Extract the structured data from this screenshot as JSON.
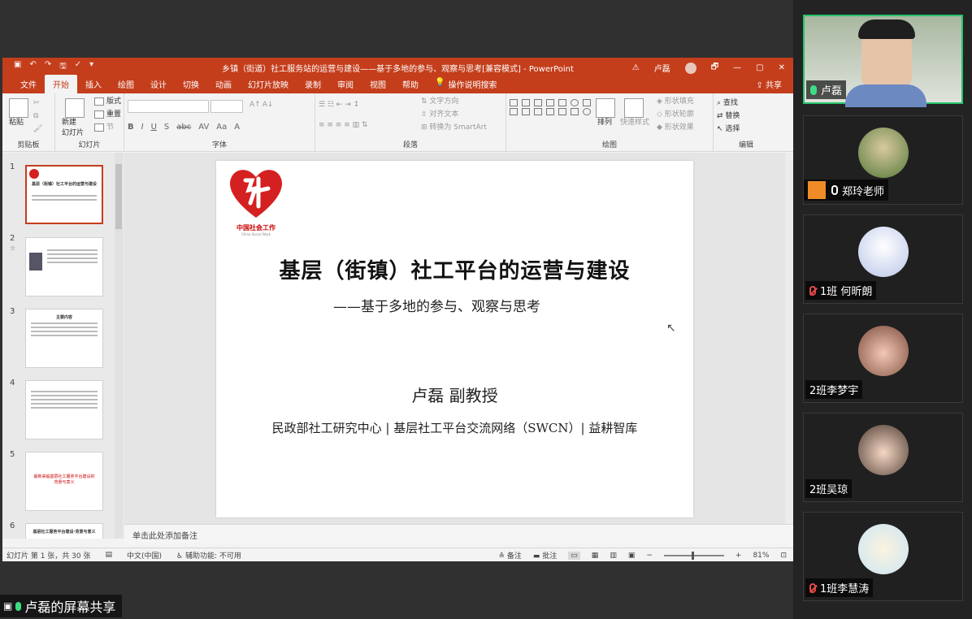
{
  "ppt": {
    "window_title": "乡镇（街道）社工服务站的运营与建设——基于多地的参与、观察与思考[兼容模式] - PowerPoint",
    "user_name": "卢磊",
    "qat": [
      "▣",
      "↶",
      "↷",
      "🖫",
      "✓",
      "▾"
    ],
    "window_buttons": [
      "⚠",
      "🗗",
      "—",
      "▢",
      "✕"
    ],
    "tabs": [
      "文件",
      "开始",
      "插入",
      "绘图",
      "设计",
      "切换",
      "动画",
      "幻灯片放映",
      "录制",
      "审阅",
      "视图",
      "帮助"
    ],
    "search_icon": "lightbulb-icon",
    "search_label": "操作说明搜索",
    "share_label": "共享",
    "ribbon": {
      "clipboard": {
        "paste": "粘贴",
        "label": "剪贴板"
      },
      "slides": {
        "new_slide": "新建\n幻灯片",
        "layout": "版式",
        "reset": "重置",
        "section": "节",
        "label": "幻灯片"
      },
      "font": {
        "label": "字体",
        "format_buttons": [
          "B",
          "I",
          "U",
          "S",
          "abc",
          "AV",
          "Aa",
          "A"
        ]
      },
      "paragraph": {
        "label": "段落",
        "text_direction": "文字方向",
        "align_text": "对齐文本",
        "smartart": "转换为 SmartArt"
      },
      "drawing": {
        "label": "绘图",
        "arrange": "排列",
        "quick_styles": "快速样式",
        "shape_fill": "形状填充",
        "shape_outline": "形状轮廓",
        "shape_effects": "形状效果"
      },
      "editing": {
        "label": "编辑",
        "find": "查找",
        "replace": "替换",
        "select": "选择"
      }
    },
    "thumbnails": [
      {
        "num": "1",
        "title": "基层（街镇）社工平台的运营与建设",
        "selected": true
      },
      {
        "num": "2",
        "star": "☆"
      },
      {
        "num": "3",
        "title": "主要内容"
      },
      {
        "num": "4"
      },
      {
        "num": "5",
        "title": "最新来临基层社工服务平台建设的背景与意义"
      },
      {
        "num": "6",
        "title": "基层社工服务平台建设·背景与意义"
      }
    ],
    "slide": {
      "logo_text": "中国社会工作",
      "logo_sub": "China Social Work",
      "title": "基层（街镇）社工平台的运营与建设",
      "subtitle": "——基于多地的参与、观察与思考",
      "author": "卢磊  副教授",
      "affiliation": "民政部社工研究中心 | 基层社工平台交流网络（SWCN）| 益耕智库"
    },
    "notes_placeholder": "单击此处添加备注",
    "status": {
      "slide_info": "幻灯片 第 1 张，共 30 张",
      "language": "中文(中国)",
      "accessibility": "辅助功能: 不可用",
      "notes_btn": "备注",
      "comments_btn": "批注",
      "zoom": "81%"
    }
  },
  "screen_share_label": "卢磊的屏幕共享",
  "participants": [
    {
      "name": "卢磊",
      "mic": "on",
      "active": true
    },
    {
      "name": "郑玲老师",
      "mic": "on",
      "host": true
    },
    {
      "name": "1班 何昕朗",
      "mic": "muted"
    },
    {
      "name": "2班李梦宇",
      "mic": "none"
    },
    {
      "name": "2班吴琼",
      "mic": "none"
    },
    {
      "name": "1班李慧涛",
      "mic": "muted"
    }
  ],
  "colors": {
    "accent": "#c43e1c",
    "active_speaker": "#26c26b"
  }
}
